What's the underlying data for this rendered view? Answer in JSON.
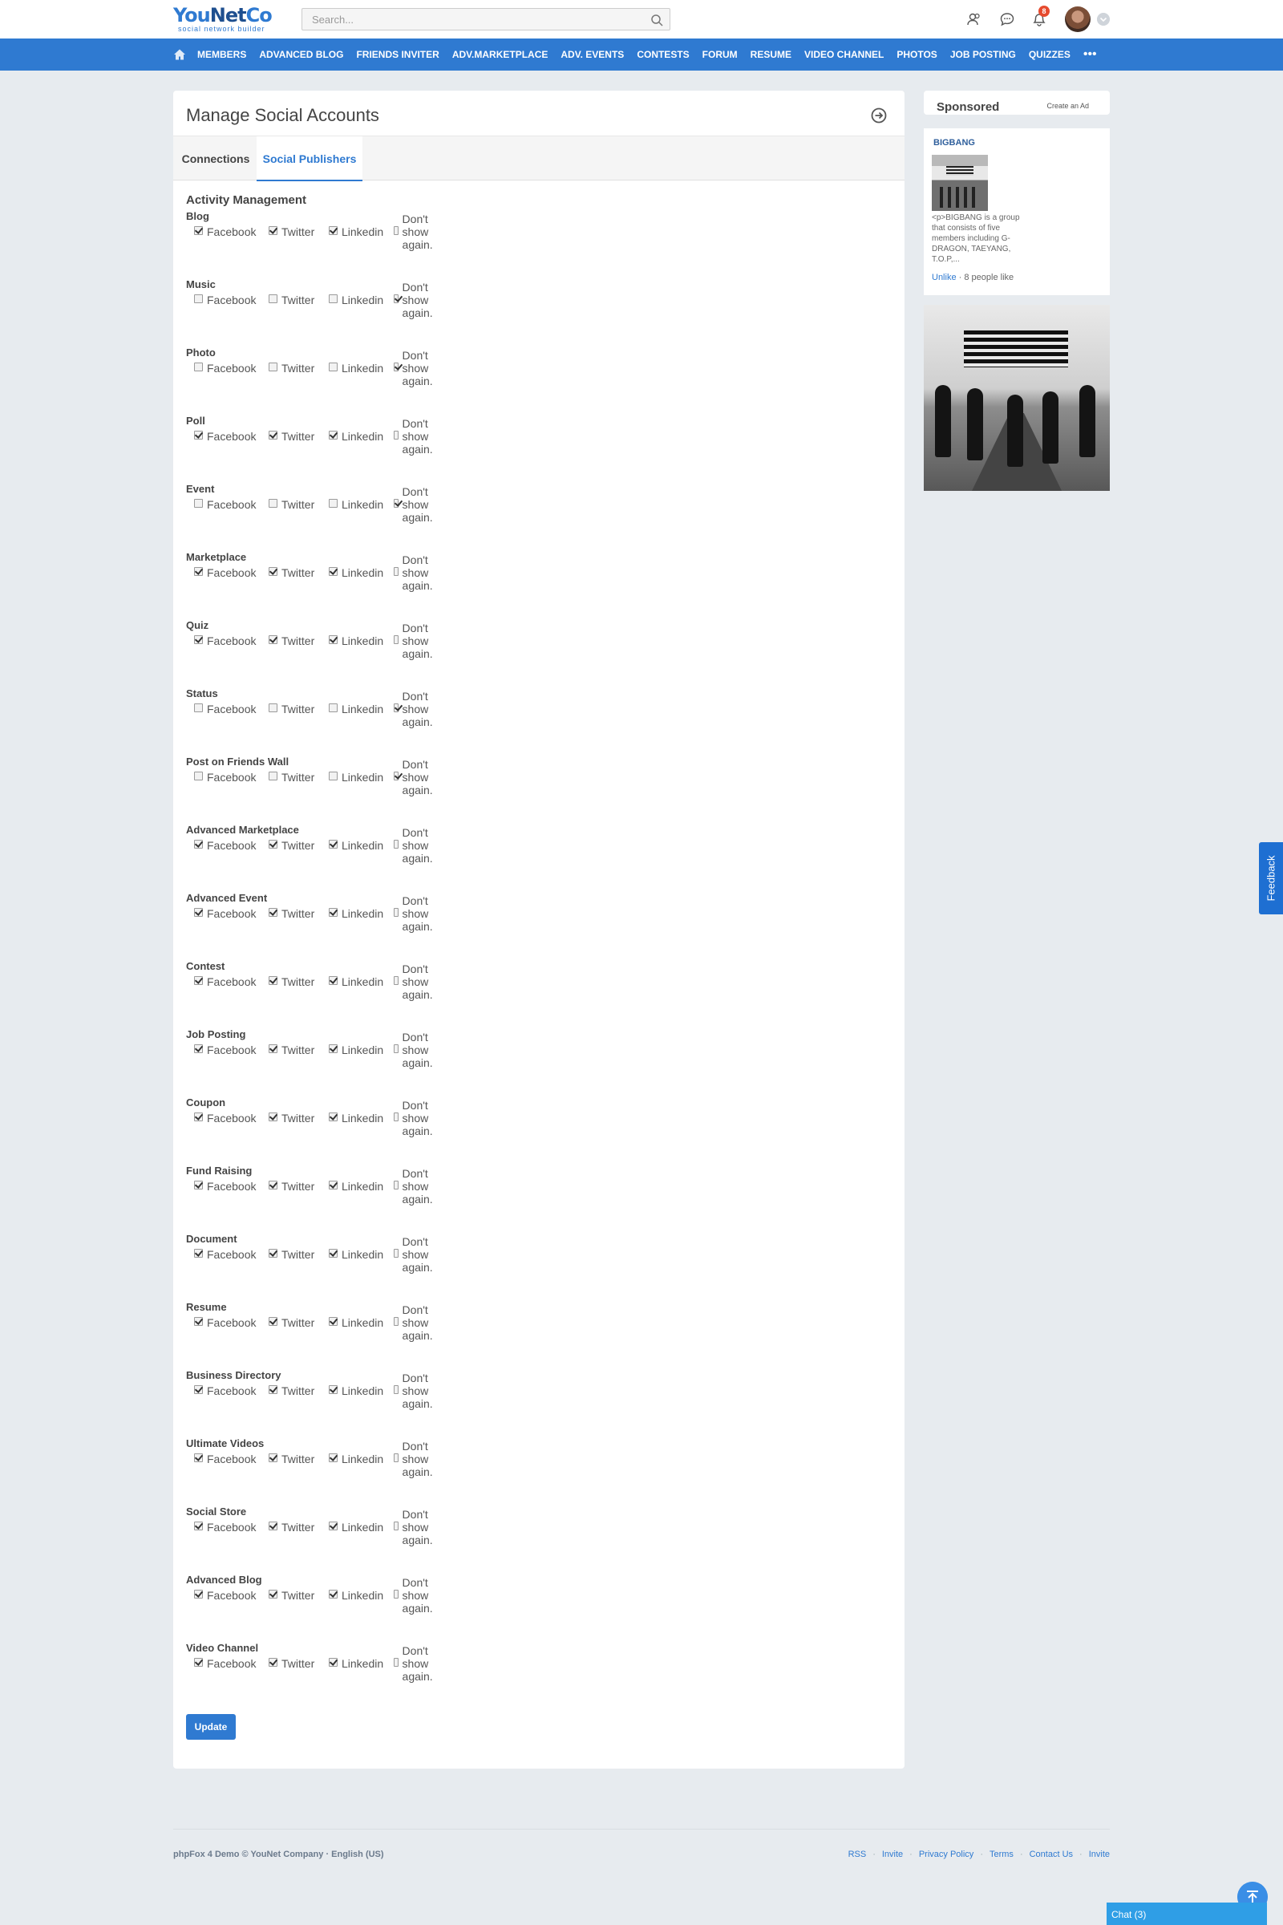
{
  "header": {
    "logo_main": {
      "you": "You",
      "net": "Net",
      "co": "Co"
    },
    "logo_tagline": "social network builder",
    "search_placeholder": "Search...",
    "notification_count": "8",
    "icons": [
      "friends-icon",
      "messages-icon",
      "notifications-icon"
    ]
  },
  "nav": {
    "items": [
      "MEMBERS",
      "ADVANCED BLOG",
      "FRIENDS INVITER",
      "ADV.MARKETPLACE",
      "ADV. EVENTS",
      "CONTESTS",
      "FORUM",
      "RESUME",
      "VIDEO CHANNEL",
      "PHOTOS",
      "JOB POSTING",
      "QUIZZES"
    ],
    "more": "•••"
  },
  "main": {
    "title": "Manage Social Accounts",
    "tabs": [
      {
        "label": "Connections"
      },
      {
        "label": "Social Publishers",
        "active": true
      }
    ],
    "section_title": "Activity Management",
    "options": [
      "Facebook",
      "Twitter",
      "Linkedin",
      "Don't show again."
    ],
    "groups": [
      {
        "label": "Blog",
        "checked": [
          true,
          true,
          true,
          false
        ]
      },
      {
        "label": "Music",
        "checked": [
          false,
          false,
          false,
          true
        ]
      },
      {
        "label": "Photo",
        "checked": [
          false,
          false,
          false,
          true
        ]
      },
      {
        "label": "Poll",
        "checked": [
          true,
          true,
          true,
          false
        ]
      },
      {
        "label": "Event",
        "checked": [
          false,
          false,
          false,
          true
        ]
      },
      {
        "label": "Marketplace",
        "checked": [
          true,
          true,
          true,
          false
        ]
      },
      {
        "label": "Quiz",
        "checked": [
          true,
          true,
          true,
          false
        ]
      },
      {
        "label": "Status",
        "checked": [
          false,
          false,
          false,
          true
        ]
      },
      {
        "label": "Post on Friends Wall",
        "checked": [
          false,
          false,
          false,
          true
        ]
      },
      {
        "label": "Advanced Marketplace",
        "checked": [
          true,
          true,
          true,
          false
        ]
      },
      {
        "label": "Advanced Event",
        "checked": [
          true,
          true,
          true,
          false
        ]
      },
      {
        "label": "Contest",
        "checked": [
          true,
          true,
          true,
          false
        ]
      },
      {
        "label": "Job Posting",
        "checked": [
          true,
          true,
          true,
          false
        ]
      },
      {
        "label": "Coupon",
        "checked": [
          true,
          true,
          true,
          false
        ]
      },
      {
        "label": "Fund Raising",
        "checked": [
          true,
          true,
          true,
          false
        ]
      },
      {
        "label": "Document",
        "checked": [
          true,
          true,
          true,
          false
        ]
      },
      {
        "label": "Resume",
        "checked": [
          true,
          true,
          true,
          false
        ]
      },
      {
        "label": "Business Directory",
        "checked": [
          true,
          true,
          true,
          false
        ]
      },
      {
        "label": "Ultimate Videos",
        "checked": [
          true,
          true,
          true,
          false
        ]
      },
      {
        "label": "Social Store",
        "checked": [
          true,
          true,
          true,
          false
        ]
      },
      {
        "label": "Advanced Blog",
        "checked": [
          true,
          true,
          true,
          false
        ]
      },
      {
        "label": "Video Channel",
        "checked": [
          true,
          true,
          true,
          false
        ]
      }
    ],
    "update_label": "Update"
  },
  "sidebar": {
    "sponsored_title": "Sponsored",
    "create_ad": "Create an Ad",
    "ad": {
      "name": "BIGBANG",
      "description": "<p>BIGBANG is a group that consists of five members including G-DRAGON, TAEYANG, T.O.P,...",
      "unlike": "Unlike",
      "likes": "· 8 people like"
    }
  },
  "feedback_label": "Feedback",
  "footer": {
    "copyright": "phpFox 4 Demo © YouNet Company · English (US)",
    "links": [
      "RSS",
      "Invite",
      "Privacy Policy",
      "Terms",
      "Contact Us",
      "Invite"
    ]
  },
  "chat_label": "Chat (3)",
  "colors": {
    "brand": "#2f7ad1",
    "background": "#e7ebef",
    "badge": "#e64a2e"
  }
}
